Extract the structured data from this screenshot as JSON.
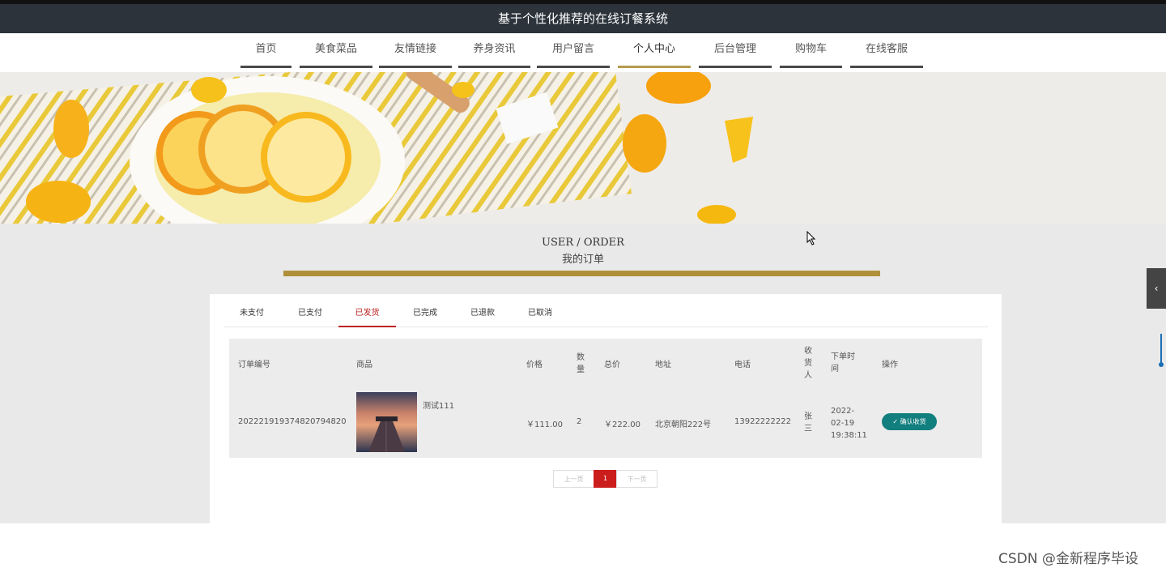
{
  "app": {
    "title": "基于个性化推荐的在线订餐系统"
  },
  "nav": {
    "items": [
      {
        "label": "首页"
      },
      {
        "label": "美食菜品"
      },
      {
        "label": "友情链接"
      },
      {
        "label": "养身资讯"
      },
      {
        "label": "用户留言"
      },
      {
        "label": "个人中心"
      },
      {
        "label": "后台管理"
      },
      {
        "label": "购物车"
      },
      {
        "label": "在线客服"
      }
    ],
    "active": "个人中心"
  },
  "section": {
    "title_en": "USER / ORDER",
    "title_zh": "我的订单",
    "accent_color": "#b08f3b"
  },
  "tabs": {
    "items": [
      {
        "label": "未支付"
      },
      {
        "label": "已支付"
      },
      {
        "label": "已发货"
      },
      {
        "label": "已完成"
      },
      {
        "label": "已退款"
      },
      {
        "label": "已取消"
      }
    ],
    "active": "已发货"
  },
  "table": {
    "headers": {
      "order_no": "订单编号",
      "product": "商品",
      "price": "价格",
      "qty": "数量",
      "total": "总价",
      "address": "地址",
      "phone": "电话",
      "receiver": "收货人",
      "time": "下单时间",
      "action": "操作"
    },
    "rows": [
      {
        "order_no": "2022219193748207948​20",
        "product_name": "测试111",
        "price": "￥111.00",
        "qty": "2",
        "total": "￥222.00",
        "address": "北京朝阳222号",
        "phone": "13922222222",
        "receiver": "张三",
        "time": "2022-02-19 19:38:11",
        "action_label": "确认收货"
      }
    ]
  },
  "pagination": {
    "prev": "上一页",
    "current": "1",
    "next": "下一页"
  },
  "watermark": "CSDN @金新程序毕设",
  "colors": {
    "topbar": "#2c333b",
    "action_button": "#127f7f",
    "active_tab": "#b22222",
    "page_current": "#cc1d1d"
  }
}
